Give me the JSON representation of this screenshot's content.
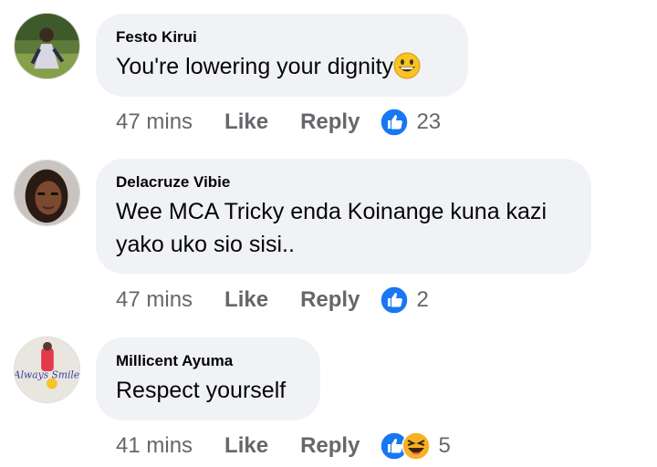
{
  "comments": [
    {
      "author": "Festo Kirui",
      "text": "You're lowering your dignity",
      "emoji_icon": "grinning-face-icon",
      "time": "47 mins",
      "like_label": "Like",
      "reply_label": "Reply",
      "reactions": [
        "like-reaction-icon"
      ],
      "reaction_count": "23"
    },
    {
      "author": "Delacruze Vibie",
      "text": "Wee MCA Tricky enda Koinange kuna kazi yako uko sio sisi..",
      "time": "47 mins",
      "like_label": "Like",
      "reply_label": "Reply",
      "reactions": [
        "like-reaction-icon"
      ],
      "reaction_count": "2"
    },
    {
      "author": "Millicent Ayuma",
      "text": "Respect yourself",
      "avatar_text": "Always Smile",
      "time": "41 mins",
      "like_label": "Like",
      "reply_label": "Reply",
      "reactions": [
        "like-reaction-icon",
        "haha-reaction-icon"
      ],
      "reaction_count": "5"
    }
  ],
  "colors": {
    "bubble": "#f0f2f5",
    "text": "#050505",
    "meta": "#65676b",
    "like_blue": "#1877f2",
    "haha_yellow": "#f7b125"
  }
}
